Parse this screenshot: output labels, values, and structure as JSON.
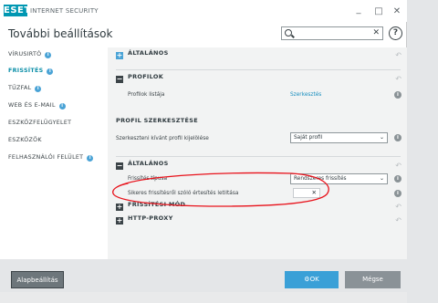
{
  "window": {
    "logo_text": "ESET",
    "app_title": "INTERNET SECURITY",
    "minimize": "_",
    "maximize": "□",
    "close": "✕"
  },
  "header": {
    "page_title": "További beállítások",
    "search_placeholder": "",
    "search_clear": "✕",
    "help": "?"
  },
  "sidebar": {
    "items": [
      {
        "label": "VÍRUSIRTÓ",
        "info": "i"
      },
      {
        "label": "FRISSÍTÉS",
        "info": "i"
      },
      {
        "label": "TŰZFAL",
        "info": "i"
      },
      {
        "label": "WEB ÉS E-MAIL",
        "info": "i"
      },
      {
        "label": "ESZKÖZFELÜGYELET"
      },
      {
        "label": "ESZKÖZÖK"
      },
      {
        "label": "FELHASZNÁLÓI FELÜLET",
        "info": "i"
      }
    ]
  },
  "main": {
    "section_general_top": "ÁLTALÁNOS",
    "section_profiles": "PROFILOK",
    "profile_list_label": "Profilok listája",
    "profile_list_link": "Szerkesztés",
    "profile_edit_heading": "PROFIL SZERKESZTÉSE",
    "profile_select_label": "Szerkeszteni kívánt profil kijelölése",
    "profile_select_value": "Saját profil",
    "section_general": "ÁLTALÁNOS",
    "update_type_label": "Frissítés típusa",
    "update_type_value": "Rendszeres frissítés",
    "notify_label": "Sikeres frissítésről szóló értesítés letiltása",
    "notify_toggle": "✕",
    "section_update_mode": "FRISSÍTÉSI MÓD",
    "section_http_proxy": "HTTP-PROXY",
    "plus": "+",
    "minus": "−",
    "undo": "↶",
    "info": "i",
    "chevron": "⌄"
  },
  "footer": {
    "default_button": "Alapbeállítás",
    "ok_button": "OK",
    "ok_icon": "⚙",
    "cancel_button": "Mégse"
  },
  "colors": {
    "accent": "#0c8fa8",
    "info_blue": "#4aa3d6",
    "ok_blue": "#3aa0d7",
    "annotation_red": "#e8111a"
  }
}
